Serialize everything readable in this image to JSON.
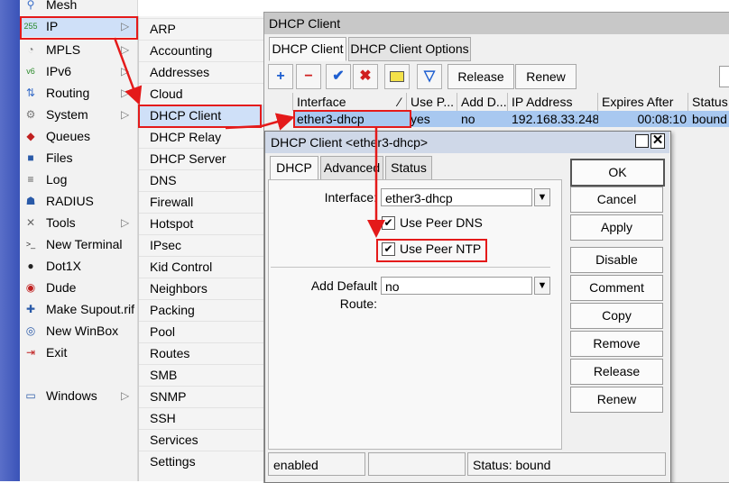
{
  "main_menu": {
    "items": [
      {
        "label": "Mesh",
        "icon": "mesh-icon",
        "glyph": "⚲",
        "color": "#3a6ec8",
        "submenu": false
      },
      {
        "label": "IP",
        "icon": "ip-icon",
        "glyph": "255",
        "color": "#2a8a2a",
        "submenu": true
      },
      {
        "label": "MPLS",
        "icon": "mpls-icon",
        "glyph": "◔",
        "color": "#888888",
        "submenu": true
      },
      {
        "label": "IPv6",
        "icon": "ipv6-icon",
        "glyph": "v6",
        "color": "#2a8a2a",
        "submenu": true
      },
      {
        "label": "Routing",
        "icon": "routing-icon",
        "glyph": "⇅",
        "color": "#3a6ec8",
        "submenu": true
      },
      {
        "label": "System",
        "icon": "gear-icon",
        "glyph": "⚙",
        "color": "#777777",
        "submenu": true
      },
      {
        "label": "Queues",
        "icon": "queues-icon",
        "glyph": "◆",
        "color": "#c02020",
        "submenu": false
      },
      {
        "label": "Files",
        "icon": "folder-icon",
        "glyph": "■",
        "color": "#2a5aa8",
        "submenu": false
      },
      {
        "label": "Log",
        "icon": "log-icon",
        "glyph": "≡",
        "color": "#555555",
        "submenu": false
      },
      {
        "label": "RADIUS",
        "icon": "radius-icon",
        "glyph": "☗",
        "color": "#2a5aa8",
        "submenu": false
      },
      {
        "label": "Tools",
        "icon": "tools-icon",
        "glyph": "✕",
        "color": "#666666",
        "submenu": true
      },
      {
        "label": "New Terminal",
        "icon": "terminal-icon",
        "glyph": ">_",
        "color": "#222222",
        "submenu": false
      },
      {
        "label": "Dot1X",
        "icon": "dot1x-icon",
        "glyph": "●",
        "color": "#222222",
        "submenu": false
      },
      {
        "label": "Dude",
        "icon": "dude-icon",
        "glyph": "◉",
        "color": "#c02020",
        "submenu": false
      },
      {
        "label": "Make Supout.rif",
        "icon": "supout-icon",
        "glyph": "✚",
        "color": "#2a5aa8",
        "submenu": false
      },
      {
        "label": "New WinBox",
        "icon": "winbox-icon",
        "glyph": "◎",
        "color": "#2a5aa8",
        "submenu": false
      },
      {
        "label": "Exit",
        "icon": "exit-icon",
        "glyph": "⇥",
        "color": "#c02020",
        "submenu": false
      }
    ],
    "windows_item": {
      "label": "Windows",
      "icon": "windows-icon"
    }
  },
  "ip_submenu": {
    "items": [
      "ARP",
      "Accounting",
      "Addresses",
      "Cloud",
      "DHCP Client",
      "DHCP Relay",
      "DHCP Server",
      "DNS",
      "Firewall",
      "Hotspot",
      "IPsec",
      "Kid Control",
      "Neighbors",
      "Packing",
      "Pool",
      "Routes",
      "SMB",
      "SNMP",
      "SSH",
      "Services",
      "Settings"
    ]
  },
  "list_window": {
    "title": "DHCP Client",
    "tabs": [
      "DHCP Client",
      "DHCP Client Options"
    ],
    "toolbar": {
      "release": "Release",
      "renew": "Renew"
    },
    "columns": [
      "Interface",
      "Use P...",
      "Add D...",
      "IP Address",
      "Expires After",
      "Status"
    ],
    "row": {
      "interface": "ether3-dhcp",
      "use_peer": "yes",
      "add_default": "no",
      "ip_address": "192.168.33.248...",
      "expires_after": "00:08:10",
      "status": "bound"
    }
  },
  "dialog": {
    "title": "DHCP Client <ether3-dhcp>",
    "tabs": [
      "DHCP",
      "Advanced",
      "Status"
    ],
    "interface_label": "Interface:",
    "interface_value": "ether3-dhcp",
    "use_peer_dns": "Use Peer DNS",
    "use_peer_ntp": "Use Peer NTP",
    "add_default_route_label": "Add Default Route:",
    "add_default_route_value": "no",
    "buttons": [
      "OK",
      "Cancel",
      "Apply",
      "Disable",
      "Comment",
      "Copy",
      "Remove",
      "Release",
      "Renew"
    ],
    "status_bar": {
      "state": "enabled",
      "status": "Status: bound"
    }
  },
  "colors": {
    "highlight": "#e41a1a",
    "selected_row": "#a8c8f0",
    "selected_menu": "#cfe0f8"
  }
}
